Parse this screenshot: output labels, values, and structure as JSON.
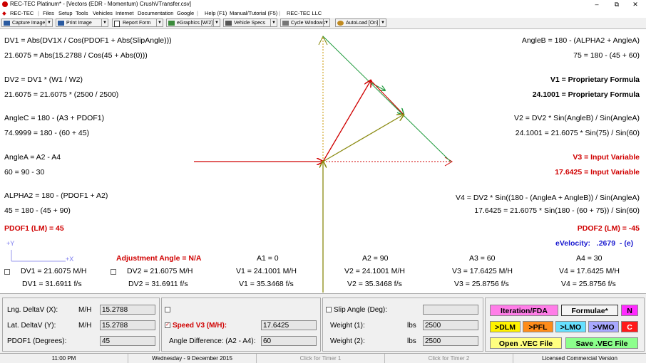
{
  "title": "REC-TEC Platinum* - [Vectors (EDR - Momentum)  CrushVTransfer.csv]",
  "window_controls": [
    "–",
    "⧉",
    "✕"
  ],
  "menu": [
    "REC-TEC",
    "Files",
    "Setup",
    "Tools",
    "Vehicles",
    "Internet",
    "Documentation",
    "Google",
    "Help (F1)",
    "Manual/Tutorial (F5)",
    "REC-TEC LLC"
  ],
  "toolbar": [
    "Capture Image",
    "Print Image",
    "Report Form",
    "eGraphics [W/2]",
    "Vehicle Specs",
    "Cycle Windows",
    "AutoLoad [On]"
  ],
  "left": {
    "dv1_formula": "DV1 = Abs(DV1X / Cos(PDOF1 + Abs(SlipAngle)))",
    "dv1_values": "21.6075 = Abs(15.2788 / Cos(45 + Abs(0)))",
    "dv2_formula": "DV2 = DV1 * (W1 / W2)",
    "dv2_values": "21.6075 = 21.6075 * (2500 / 2500)",
    "anglec_formula": "AngleC = 180 - (A3 + PDOF1)",
    "anglec_values": "74.9999 = 180 - (60 + 45)",
    "anglea_formula": "AngleA = A2 - A4",
    "anglea_values": "60 = 90 - 30",
    "alpha2_formula": "ALPHA2 = 180 - (PDOF1 + A2)",
    "alpha2_values": "45 = 180 - (45 + 90)",
    "pdof1": "PDOF1 (LM) = 45"
  },
  "right": {
    "angleb_formula": "AngleB = 180 - (ALPHA2 + AngleA)",
    "angleb_values": "75 = 180 - (45 + 60)",
    "v1_formula": "V1 = Proprietary Formula",
    "v1_values": "24.1001 = Proprietary Formula",
    "v2_formula": "V2 = DV2 * Sin(AngleB) / Sin(AngleA)",
    "v2_values": "24.1001 = 21.6075 * Sin(75) / Sin(60)",
    "v3_formula": "V3 = Input Variable",
    "v3_values": "17.6425 = Input Variable",
    "v4_formula": "V4 = DV2 * Sin((180 - (AngleA + AngleB)) / Sin(AngleA)",
    "v4_values": "17.6425 = 21.6075 * Sin(180 - (60 + 75)) / Sin(60)",
    "pdof2": "PDOF2 (LM) = -45",
    "evelocity_label": "eVelocity:",
    "evelocity_value": ".2679",
    "evelocity_sign": "-  (e)"
  },
  "axes": {
    "y": "+Y",
    "x": "+X"
  },
  "adjustment_angle": "Adjustment Angle = N/A",
  "angles": {
    "a1": "A1 = 0",
    "a2": "A2 = 90",
    "a3": "A3 = 60",
    "a4": "A4 = 30"
  },
  "results_mh": {
    "dv1": "DV1 = 21.6075  M/H",
    "dv2": "DV2 = 21.6075  M/H",
    "v1": "V1 = 24.1001  M/H",
    "v2": "V2 = 24.1001  M/H",
    "v3": "V3 = 17.6425  M/H",
    "v4": "V4 = 17.6425  M/H"
  },
  "results_fs": {
    "dv1": "DV1 = 31.6911  f/s",
    "dv2": "DV2 = 31.6911  f/s",
    "v1": "V1 = 35.3468  f/s",
    "v2": "V2 = 35.3468  f/s",
    "v3": "V3 = 25.8756  f/s",
    "v4": "V4 = 25.8756  f/s"
  },
  "inputs": {
    "lng_label": "Lng. DeltaV (X):",
    "lng_unit": "M/H",
    "lng_value": "15.2788",
    "lat_label": "Lat. DeltaV (Y):",
    "lat_unit": "M/H",
    "lat_value": "15.2788",
    "pdof1_label": "PDOF1 (Degrees):",
    "pdof1_value": "45",
    "speed_label": "Speed V3 (M/H):",
    "speed_value": "17.6425",
    "angle_diff_label": "Angle Difference: (A2 - A4):",
    "angle_diff_value": "60",
    "slip_label": "Slip Angle (Deg):",
    "slip_value": "",
    "w1_label": "Weight (1):",
    "w1_unit": "lbs",
    "w1_value": "2500",
    "w2_label": "Weight (2):",
    "w2_unit": "lbs",
    "w2_value": "2500"
  },
  "buttons": {
    "iteration": "Iteration/FDA",
    "formulae": "Formulae*",
    "n": "N",
    "dlm": ">DLM",
    "pfl": ">PFL",
    "lmo": ">LMO",
    "vmo": ">VMO",
    "c": "C",
    "open": "Open  .VEC File",
    "save": "Save  .VEC File"
  },
  "status": {
    "time": "11:00 PM",
    "date": "Wednesday  -  9 December 2015",
    "timer1": "Click for Timer 1",
    "timer2": "Click for Timer 2",
    "license": "Licensed Commercial Version"
  },
  "colors": {
    "red": "#d00000",
    "blue": "#1a1ad0",
    "green": "#1e9a3c",
    "olive": "#8a8a10",
    "magenta": "#ff7de8",
    "yellow": "#fff200",
    "orange": "#ff8c1a",
    "cyan": "#66e0ff",
    "lavender": "#a8a8ff",
    "lime": "#8cff8c"
  }
}
